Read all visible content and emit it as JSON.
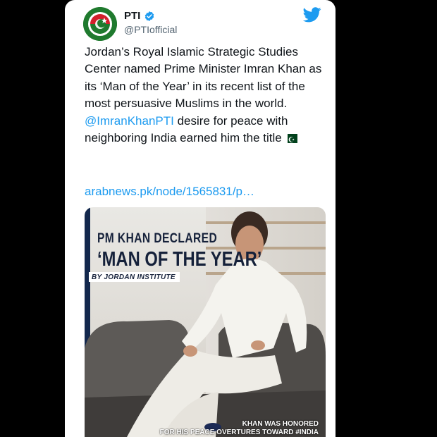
{
  "tweet": {
    "display_name": "PTI",
    "handle": "@PTIofficial",
    "verified": true,
    "text_part1": "Jordan’s Royal Islamic Strategic Studies Center named Prime Minister Imran Khan as its ‘Man of the Year’ in its recent list of the most persuasive Muslims in the world. ",
    "mention": "@ImranKhanPTI",
    "text_part2": " desire for peace with neighboring India earned him the title",
    "flag_icon": "pakistan-flag-emoji",
    "link": "arabnews.pk/node/1565831/p…"
  },
  "media": {
    "title_line1": "PM KHAN DECLARED",
    "title_line2": "‘MAN OF THE YEAR’",
    "byline": "BY JORDAN INSTITUTE",
    "caption_line1": "KHAN WAS HONORED",
    "caption_line2": "FOR HIS PEACE OVERTURES TOWARD #INDIA"
  },
  "colors": {
    "accent": "#1d9bf0",
    "text": "#0f1419",
    "muted": "#536471",
    "background": "#000000"
  }
}
